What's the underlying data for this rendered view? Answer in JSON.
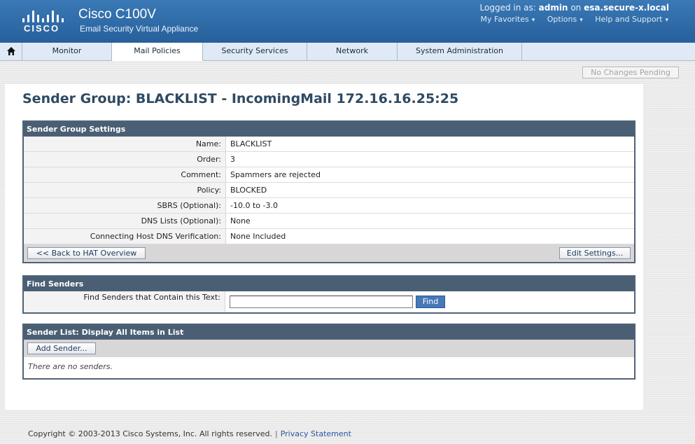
{
  "header": {
    "logo_text": "CISCO",
    "product_name": "Cisco C100V",
    "product_sub": "Email Security Virtual Appliance",
    "login_prefix": "Logged in as:",
    "user": "admin",
    "login_on": "on",
    "host": "esa.secure-x.local",
    "util_nav": [
      "My Favorites",
      "Options",
      "Help and Support"
    ]
  },
  "nav": {
    "tabs": [
      "Monitor",
      "Mail Policies",
      "Security Services",
      "Network",
      "System Administration"
    ],
    "active": "Mail Policies"
  },
  "pending_label": "No Changes Pending",
  "page_title": "Sender Group: BLACKLIST - IncomingMail 172.16.16.25:25",
  "settings": {
    "title": "Sender Group Settings",
    "rows": [
      {
        "label": "Name:",
        "value": "BLACKLIST"
      },
      {
        "label": "Order:",
        "value": "3"
      },
      {
        "label": "Comment:",
        "value": "Spammers are rejected"
      },
      {
        "label": "Policy:",
        "value": "BLOCKED"
      },
      {
        "label": "SBRS (Optional):",
        "value": "-10.0 to -3.0"
      },
      {
        "label": "DNS Lists (Optional):",
        "value": "None"
      },
      {
        "label": "Connecting Host DNS Verification:",
        "value": "None Included"
      }
    ],
    "back_button": "<< Back to HAT Overview",
    "edit_button": "Edit Settings..."
  },
  "find": {
    "title": "Find Senders",
    "label": "Find Senders that Contain this Text:",
    "input_value": "",
    "button": "Find"
  },
  "sender_list": {
    "title": "Sender List: Display All Items in List",
    "add_button": "Add Sender...",
    "empty_text": "There are no senders."
  },
  "footer": {
    "copyright": "Copyright © 2003-2013 Cisco Systems, Inc. All rights reserved.",
    "separator": "|",
    "privacy": "Privacy Statement"
  }
}
